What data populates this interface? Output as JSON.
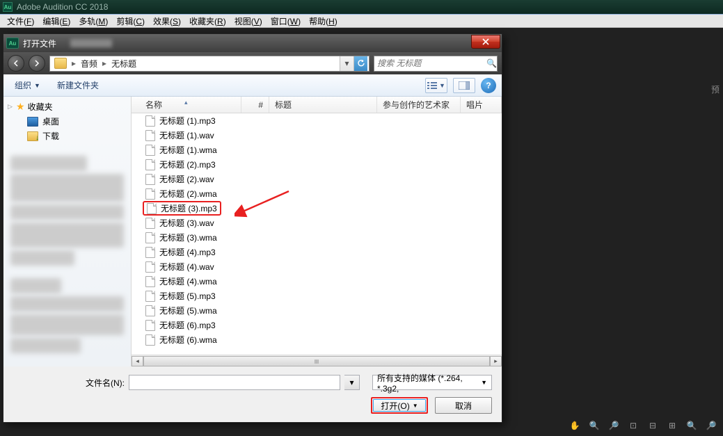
{
  "app": {
    "title": "Adobe Audition CC 2018",
    "icon_text": "Au"
  },
  "menubar": [
    {
      "label": "文件",
      "key": "F"
    },
    {
      "label": "编辑",
      "key": "E"
    },
    {
      "label": "多轨",
      "key": "M"
    },
    {
      "label": "剪辑",
      "key": "C"
    },
    {
      "label": "效果",
      "key": "S"
    },
    {
      "label": "收藏夹",
      "key": "R"
    },
    {
      "label": "视图",
      "key": "V"
    },
    {
      "label": "窗口",
      "key": "W"
    },
    {
      "label": "帮助",
      "key": "H"
    }
  ],
  "right_hint": "预",
  "dialog": {
    "title": "打开文件",
    "breadcrumbs": [
      "音频",
      "无标题"
    ],
    "search_placeholder": "搜索 无标题",
    "toolbar": {
      "organize": "组织",
      "new_folder": "新建文件夹"
    },
    "columns": {
      "name": "名称",
      "num": "#",
      "title": "标题",
      "artist": "参与创作的艺术家",
      "album": "唱片"
    },
    "sidebar": {
      "favorites": "收藏夹",
      "desktop": "桌面",
      "downloads": "下载"
    },
    "files": [
      "无标题 (1).mp3",
      "无标题 (1).wav",
      "无标题 (1).wma",
      "无标题 (2).mp3",
      "无标题 (2).wav",
      "无标题 (2).wma",
      "无标题 (3).mp3",
      "无标题 (3).wav",
      "无标题 (3).wma",
      "无标题 (4).mp3",
      "无标题 (4).wav",
      "无标题 (4).wma",
      "无标题 (5).mp3",
      "无标题 (5).wma",
      "无标题 (6).mp3",
      "无标题 (6).wma"
    ],
    "selected_index": 6,
    "filename_label": "文件名(N):",
    "filename_value": "",
    "filter_label": "所有支持的媒体 (*.264, *.3g2,",
    "open_btn": "打开(O)",
    "cancel_btn": "取消"
  }
}
